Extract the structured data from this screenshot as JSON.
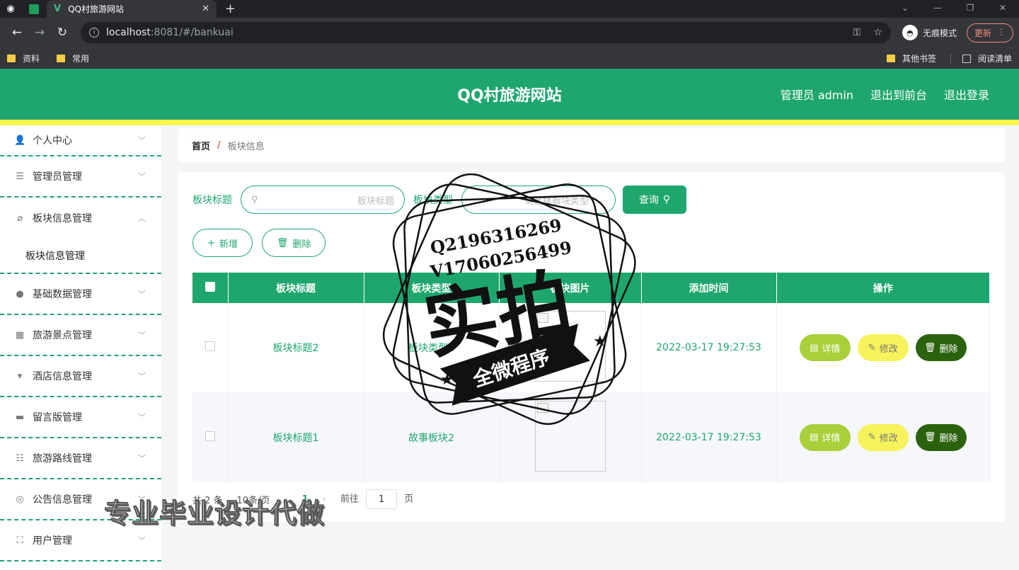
{
  "browser": {
    "tab_title": "QQ村旅游网站",
    "new_tab": "+",
    "url_host": "localhost",
    "url_path": ":8081/#/bankuai",
    "incognito_label": "无痕模式",
    "update_label": "更新",
    "bookmarks_left": [
      "资料",
      "常用"
    ],
    "bookmark_other": "其他书签",
    "reading_list": "阅读清单"
  },
  "header": {
    "title": "QQ村旅游网站",
    "admin": "管理员 admin",
    "to_front": "退出到前台",
    "logout": "退出登录"
  },
  "sidebar": {
    "items": [
      {
        "label": "个人中心",
        "icon": "person-icon",
        "glyph": "👤",
        "chev": "﹀"
      },
      {
        "label": "管理员管理",
        "icon": "list-icon",
        "glyph": "☰",
        "chev": "﹀"
      },
      {
        "label": "板块信息管理",
        "icon": "bell-off-icon",
        "glyph": "⌀",
        "chev": "︿"
      },
      {
        "label": "基础数据管理",
        "icon": "bulb-icon",
        "glyph": "●",
        "chev": "﹀"
      },
      {
        "label": "旅游景点管理",
        "icon": "grid-icon",
        "glyph": "▦",
        "chev": "﹀"
      },
      {
        "label": "酒店信息管理",
        "icon": "cup-icon",
        "glyph": "▾",
        "chev": "﹀"
      },
      {
        "label": "留言版管理",
        "icon": "message-icon",
        "glyph": "▬",
        "chev": "﹀"
      },
      {
        "label": "旅游路线管理",
        "icon": "sliders-icon",
        "glyph": "☷",
        "chev": "﹀"
      },
      {
        "label": "公告信息管理",
        "icon": "target-icon",
        "glyph": "◎",
        "chev": "﹀"
      },
      {
        "label": "用户管理",
        "icon": "frame-icon",
        "glyph": "⛶",
        "chev": "﹀"
      }
    ],
    "sub_item": "板块信息管理"
  },
  "breadcrumb": {
    "home": "首页",
    "separator": "/",
    "current": "板块信息"
  },
  "search": {
    "title_label": "板块标题",
    "title_placeholder": "板块标题",
    "type_label": "板块类型",
    "type_placeholder": "请选择板块类型",
    "query_label": "查询"
  },
  "actions": {
    "add": "新增",
    "delete": "删除"
  },
  "table": {
    "columns": [
      "板块标题",
      "板块类型",
      "板块图片",
      "添加时间",
      "操作"
    ],
    "rows": [
      {
        "title": "板块标题2",
        "type": "板块类型1",
        "time": "2022-03-17 19:27:53"
      },
      {
        "title": "板块标题1",
        "type": "故事板块2",
        "time": "2022-03-17 19:27:53"
      }
    ],
    "op_detail": "详情",
    "op_edit": "修改",
    "op_delete": "删除"
  },
  "pager": {
    "total": "共 2 条",
    "page_size": "10条/页",
    "current_page": "1",
    "goto": "前往",
    "goto_value": "1",
    "page_unit": "页"
  },
  "watermark": {
    "qq": "Q2196316269",
    "vx": "V17060256499",
    "big": "实拍",
    "banner": "全微程序",
    "bottom": "专业毕业设计代做"
  },
  "colors": {
    "primary": "#1ea66e",
    "yellow": "#f7f54e",
    "detail": "#a9cf3a",
    "edit": "#f6f25c",
    "delete": "#2b620e"
  }
}
